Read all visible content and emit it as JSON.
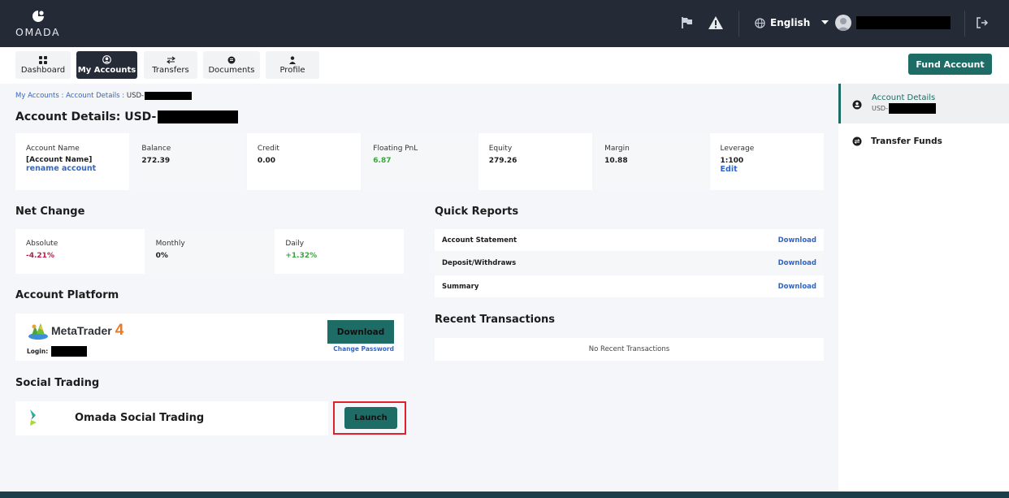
{
  "header": {
    "logo_text": "OMADA",
    "language": "English",
    "icons": [
      "flag-icon",
      "warning-icon",
      "globe-icon",
      "chevron-down-icon",
      "avatar",
      "logout-icon"
    ]
  },
  "nav": {
    "tabs": [
      {
        "label": "Dashboard",
        "icon": "grid-icon"
      },
      {
        "label": "My Accounts",
        "icon": "user-circle-icon",
        "active": true
      },
      {
        "label": "Transfers",
        "icon": "transfer-arrows-icon"
      },
      {
        "label": "Documents",
        "icon": "document-icon"
      },
      {
        "label": "Profile",
        "icon": "person-icon"
      }
    ],
    "fund_account": "Fund Account"
  },
  "breadcrumb": {
    "item1": "My Accounts",
    "sep": " : ",
    "item2": "Account Details",
    "item3": "USD-"
  },
  "page_title": "Account Details: USD-",
  "account": {
    "name_label": "Account Name",
    "name_value": "[Account Name]",
    "rename": "rename account",
    "balance_label": "Balance",
    "balance_value": "272.39",
    "credit_label": "Credit",
    "credit_value": "0.00",
    "pnl_label": "Floating PnL",
    "pnl_value": "6.87",
    "equity_label": "Equity",
    "equity_value": "279.26",
    "margin_label": "Margin",
    "margin_value": "10.88",
    "leverage_label": "Leverage",
    "leverage_value": "1:100",
    "edit": "Edit"
  },
  "net_change": {
    "title": "Net Change",
    "absolute_label": "Absolute",
    "absolute_value": "-4.21%",
    "monthly_label": "Monthly",
    "monthly_value": "0%",
    "daily_label": "Daily",
    "daily_value": "+1.32%"
  },
  "quick_reports": {
    "title": "Quick Reports",
    "rows": [
      {
        "name": "Account Statement",
        "action": "Download"
      },
      {
        "name": "Deposit/Withdraws",
        "action": "Download"
      },
      {
        "name": "Summary",
        "action": "Download"
      }
    ]
  },
  "platform": {
    "title": "Account Platform",
    "name": "MetaTrader",
    "version": "4",
    "login_label": "Login:",
    "download": "Download",
    "change_password": "Change Password"
  },
  "recent": {
    "title": "Recent Transactions",
    "empty": "No Recent Transactions"
  },
  "social": {
    "title": "Social Trading",
    "name": "Omada Social Trading",
    "launch": "Launch"
  },
  "sidebar": {
    "account_details": "Account Details",
    "account_sub": "USD-",
    "transfer_funds": "Transfer Funds"
  },
  "colors": {
    "topbar": "#252a37",
    "accent": "#1e6c66",
    "link": "#2f66c9",
    "positive": "#3aa63a",
    "negative": "#b0204a",
    "highlight": "#e0202a"
  }
}
